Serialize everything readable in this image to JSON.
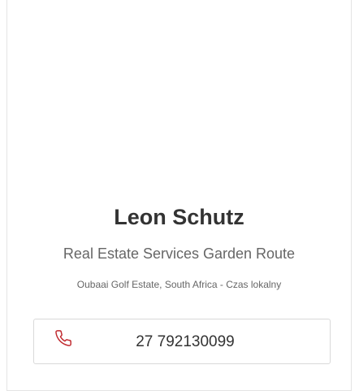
{
  "agent": {
    "name": "Leon Schutz",
    "company": "Real Estate Services Garden Route",
    "location": "Oubaai Golf Estate, South Africa - Czas lokalny",
    "phone": "27 792130099"
  },
  "icons": {
    "phone": "phone-icon"
  },
  "colors": {
    "phone_icon": "#c0292f",
    "name_text": "#333333",
    "secondary_text": "#666666",
    "border": "#e4e4e4"
  }
}
